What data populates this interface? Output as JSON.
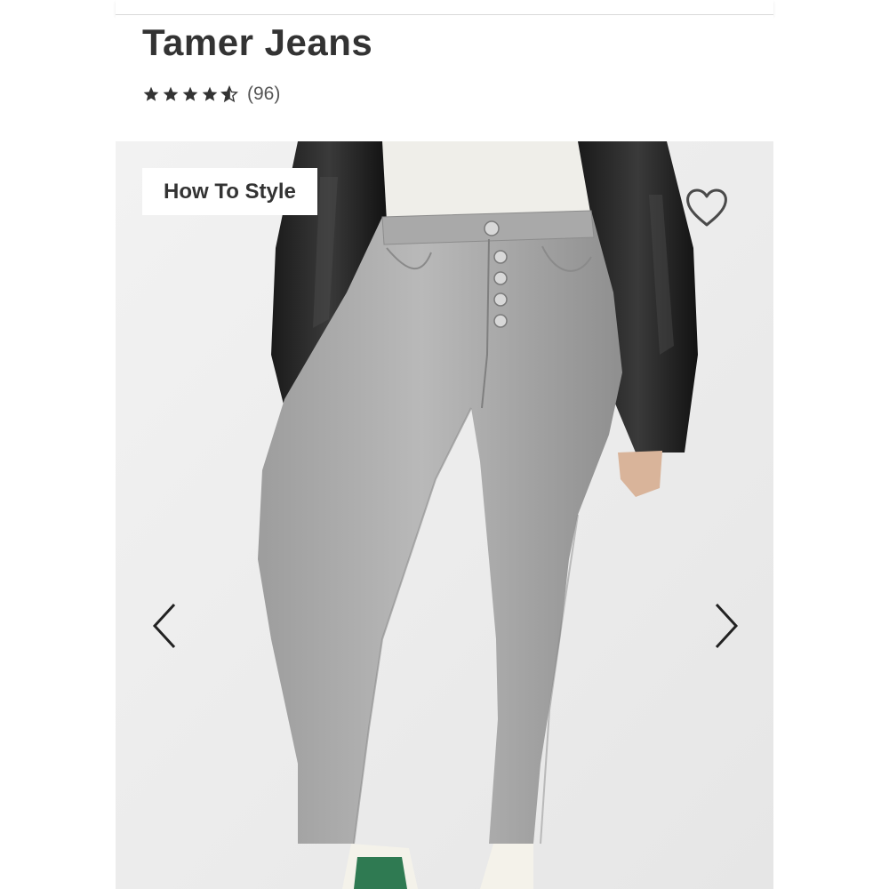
{
  "product": {
    "title": "Tamer Jeans",
    "rating": 4.5,
    "rating_max": 5,
    "review_count": "(96)"
  },
  "gallery": {
    "style_tag_label": "How To Style",
    "icons": {
      "wishlist": "heart-icon",
      "prev": "chevron-left-icon",
      "next": "chevron-right-icon"
    }
  },
  "colors": {
    "title_text": "#333333",
    "star": "#333333",
    "gallery_bg": "#ececec"
  }
}
